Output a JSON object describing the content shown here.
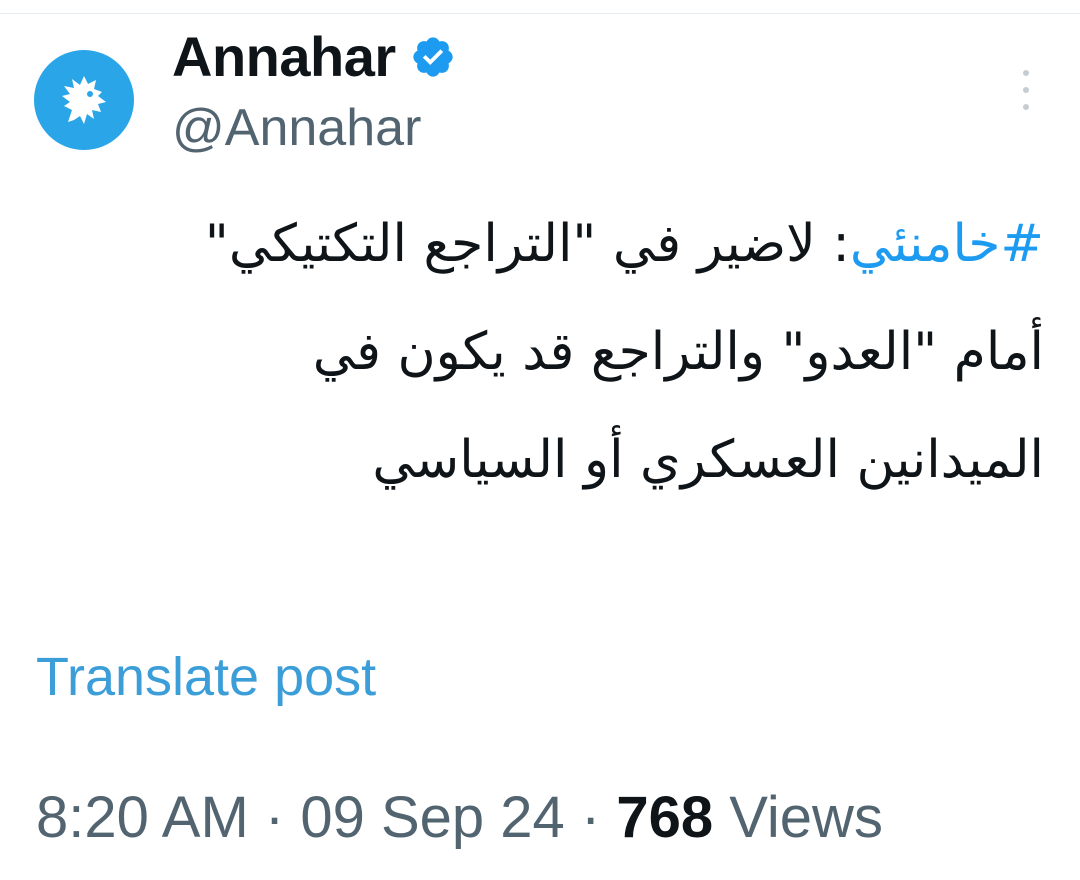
{
  "author": {
    "display_name": "Annahar",
    "handle": "@Annahar",
    "verified": true,
    "avatar_icon": "rooster-logo-icon",
    "avatar_color": "#2aa6e8",
    "verified_color": "#1d9bf0"
  },
  "post": {
    "hashtag": "#خامنئي",
    "text": ": لاضير في \"التراجع التكتيكي\" أمام \"العدو\" والتراجع قد يكون في الميدانين العسكري أو السياسي"
  },
  "actions": {
    "translate_label": "Translate post",
    "more_icon": "more-vertical-icon"
  },
  "meta": {
    "time": "8:20 AM",
    "date": "09 Sep 24",
    "separator": " · ",
    "views_count": "768",
    "views_label": "Views"
  }
}
